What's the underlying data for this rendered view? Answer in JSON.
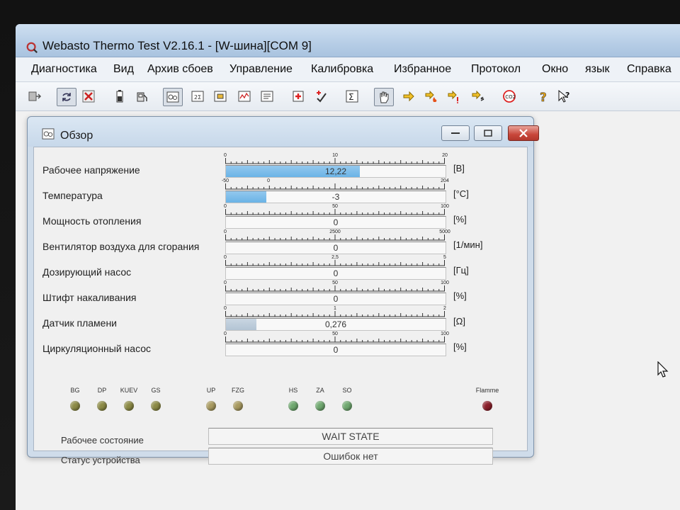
{
  "app": {
    "title": "Webasto Thermo Test V2.16.1 - [W-шина][COM 9]"
  },
  "menu": [
    "Диагностика",
    "Вид",
    "Архив сбоев",
    "Управление",
    "Калибровка",
    "Избранное",
    "Протокол",
    "Окно",
    "язык",
    "Справка"
  ],
  "toolbar": {
    "icons": [
      "exit-icon",
      "refresh-icon",
      "stop-icon",
      "battery-icon",
      "fuel-icon",
      "overview-icon",
      "counter-icon",
      "chip-icon",
      "graph-icon",
      "list-icon",
      "medical-icon",
      "plus-check-icon",
      "sigma-icon",
      "hand-icon",
      "arrow-right-icon",
      "arrow-fire-icon",
      "arrow-warn-icon",
      "arrow-fan-icon",
      "co2-icon",
      "help-icon",
      "context-help-icon"
    ],
    "co2_label": "CO2"
  },
  "window": {
    "title": "Обзор"
  },
  "gauges": [
    {
      "label": "Рабочее напряжение",
      "ticks": [
        "0",
        "10",
        "20"
      ],
      "min": 0,
      "max": 20,
      "value": 12.22,
      "display": "12,22",
      "unit": "[В]"
    },
    {
      "label": "Температура",
      "ticks": [
        "-50",
        "0",
        "204"
      ],
      "min": -50,
      "max": 204,
      "value": -3,
      "display": "-3",
      "unit": "[°C]"
    },
    {
      "label": "Мощность отопления",
      "ticks": [
        "0",
        "50",
        "100"
      ],
      "min": 0,
      "max": 100,
      "value": 0,
      "display": "0",
      "unit": "[%]"
    },
    {
      "label": "Вентилятор воздуха для сгорания",
      "ticks": [
        "0",
        "2500",
        "5000"
      ],
      "min": 0,
      "max": 5000,
      "value": 0,
      "display": "0",
      "unit": "[1/мин]"
    },
    {
      "label": "Дозирующий насос",
      "ticks": [
        "0",
        "2,5",
        "5"
      ],
      "min": 0,
      "max": 5,
      "value": 0,
      "display": "0",
      "unit": "[Гц]"
    },
    {
      "label": "Штифт накаливания",
      "ticks": [
        "0",
        "50",
        "100"
      ],
      "min": 0,
      "max": 100,
      "value": 0,
      "display": "0",
      "unit": "[%]"
    },
    {
      "label": "Датчик пламени",
      "ticks": [
        "0",
        "1",
        "2"
      ],
      "min": 0,
      "max": 2,
      "value": 0.276,
      "display": "0,276",
      "unit": "[Ω]"
    },
    {
      "label": "Циркуляционный насос",
      "ticks": [
        "0",
        "50",
        "100"
      ],
      "min": 0,
      "max": 100,
      "value": 0,
      "display": "0",
      "unit": "[%]"
    }
  ],
  "leds": [
    {
      "label": "BG",
      "color": "#8c8a45"
    },
    {
      "label": "DP",
      "color": "#8c8a45"
    },
    {
      "label": "KUEV",
      "color": "#8c8a45"
    },
    {
      "label": "GS",
      "color": "#8c8a45"
    },
    {
      "label": "UP",
      "color": "#a89a60"
    },
    {
      "label": "FZG",
      "color": "#a89a60"
    },
    {
      "label": "HS",
      "color": "#6fa86f"
    },
    {
      "label": "ZA",
      "color": "#6fa86f"
    },
    {
      "label": "SO",
      "color": "#6fa86f"
    },
    {
      "label": "Flamme",
      "color": "#8a1f2a"
    }
  ],
  "status": {
    "operating_state_label": "Рабочее состояние",
    "operating_state_value": "WAIT STATE",
    "device_status_label": "Статус устройства",
    "device_status_value": "Ошибок нет"
  }
}
